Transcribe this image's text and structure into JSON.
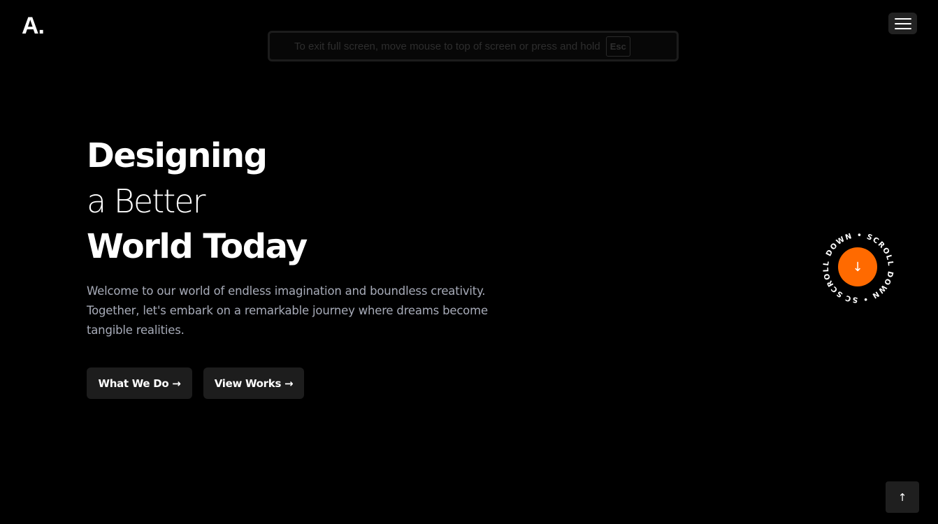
{
  "header": {
    "logo": "A.",
    "menu_icon": "hamburger-menu-icon"
  },
  "fullscreen_notice": {
    "text": "To exit full screen, move mouse to top of screen or press and hold",
    "key": "Esc"
  },
  "hero": {
    "line1": "Designing",
    "line2": "a Better",
    "line3": "World Today",
    "intro": "Welcome to our world of endless imagination and boundless creativity. Together, let's embark on a remarkable journey where dreams become tangible realities.",
    "buttons": {
      "what_we_do": "What We Do →",
      "view_works": "View Works →"
    }
  },
  "scroll_badge": {
    "ring_text": "SCROLL DOWN • SCROLL DOWN • SCROLL D",
    "arrow": "↓",
    "accent_color": "#ff6a00"
  },
  "back_to_top": {
    "arrow": "↑"
  },
  "colors": {
    "background": "#000000",
    "text": "#ffffff",
    "muted_text": "#a7abb8",
    "button_bg": "#1d1d1d",
    "accent": "#ff6a00"
  }
}
